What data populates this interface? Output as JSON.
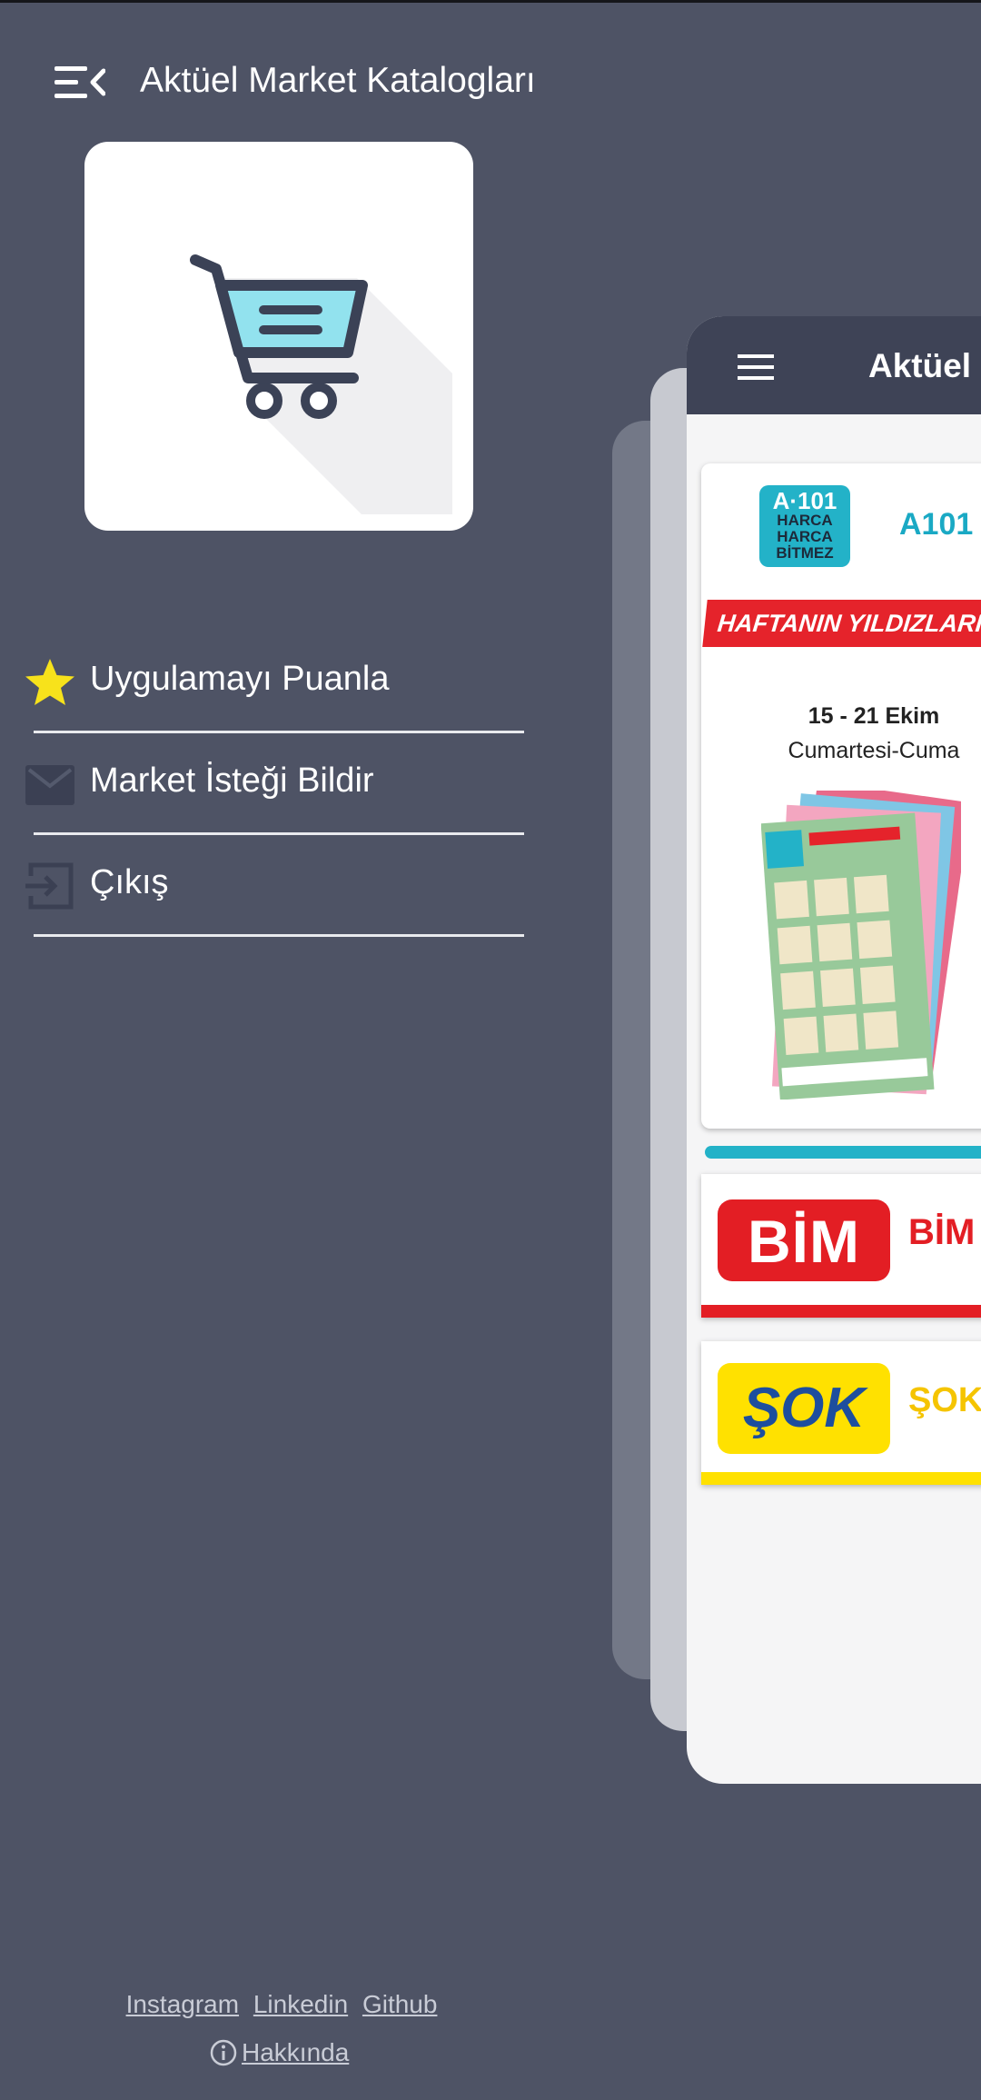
{
  "drawer": {
    "title": "Aktüel Market Katalogları",
    "menu_icon": "menu-collapse-icon",
    "logo_icon": "shopping-cart-icon",
    "items": [
      {
        "icon": "star-icon",
        "label": "Uygulamayı Puanla"
      },
      {
        "icon": "mail-icon",
        "label": "Market İsteği Bildir"
      },
      {
        "icon": "exit-icon",
        "label": "Çıkış"
      }
    ]
  },
  "footer": {
    "links": [
      "Instagram",
      "Linkedin",
      "Github"
    ],
    "about": "Hakkında"
  },
  "preview": {
    "title": "Aktüel M",
    "a101": {
      "logo_top": "A·101",
      "logo_lines": [
        "HARCA",
        "HARCA",
        "BİTMEZ"
      ],
      "name": "A101",
      "ribbon": "HAFTANIN YILDIZLARI",
      "date": "15 - 21 Ekim",
      "days": "Cumartesi-Cuma"
    },
    "bim": {
      "logo": "BİM",
      "name": "BİM A"
    },
    "sok": {
      "logo": "ŞOK",
      "name": "ŞOK A"
    }
  },
  "colors": {
    "background": "#4e5365",
    "app_bar": "#3e4356",
    "a101": "#23b2c8",
    "bim": "#e31e24",
    "sok": "#ffe100",
    "star": "#f7e21b"
  }
}
